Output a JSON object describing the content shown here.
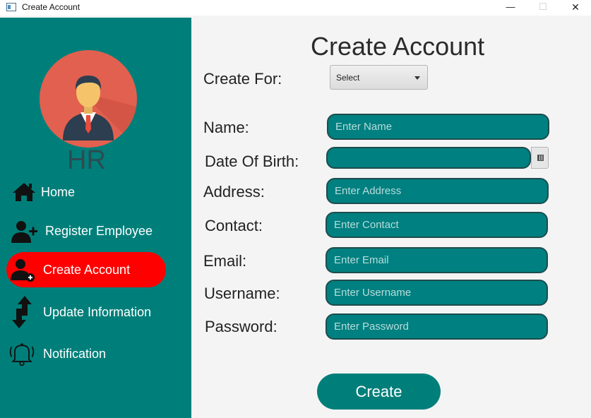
{
  "window": {
    "title": "Create Account",
    "minimize_glyph": "—",
    "maximize_glyph": "☐",
    "close_glyph": "✕"
  },
  "sidebar": {
    "role": "HR",
    "items": [
      {
        "label": "Home",
        "icon": "home-icon",
        "active": false
      },
      {
        "label": "Register Employee",
        "icon": "add-user-icon",
        "active": false
      },
      {
        "label": "Create Account",
        "icon": "create-account-icon",
        "active": true
      },
      {
        "label": "Update Information",
        "icon": "up-down-arrows-icon",
        "active": false
      },
      {
        "label": "Notification",
        "icon": "bell-icon",
        "active": false
      }
    ]
  },
  "form": {
    "title": "Create Account",
    "create_for": {
      "label": "Create For:",
      "value": "Select"
    },
    "name": {
      "label": "Name:",
      "placeholder": "Enter Name"
    },
    "dob": {
      "label": "Date Of Birth:"
    },
    "address": {
      "label": "Address:",
      "placeholder": "Enter Address"
    },
    "contact": {
      "label": "Contact:",
      "placeholder": "Enter Contact"
    },
    "email": {
      "label": "Email:",
      "placeholder": "Enter Email"
    },
    "username": {
      "label": "Username:",
      "placeholder": "Enter Username"
    },
    "password": {
      "label": "Password:",
      "placeholder": "Enter Password"
    },
    "submit_label": "Create"
  },
  "colors": {
    "sidebar": "#007f7a",
    "active_item": "#ff0000",
    "avatar_bg": "#e2604f",
    "input_fill": "#008080"
  }
}
